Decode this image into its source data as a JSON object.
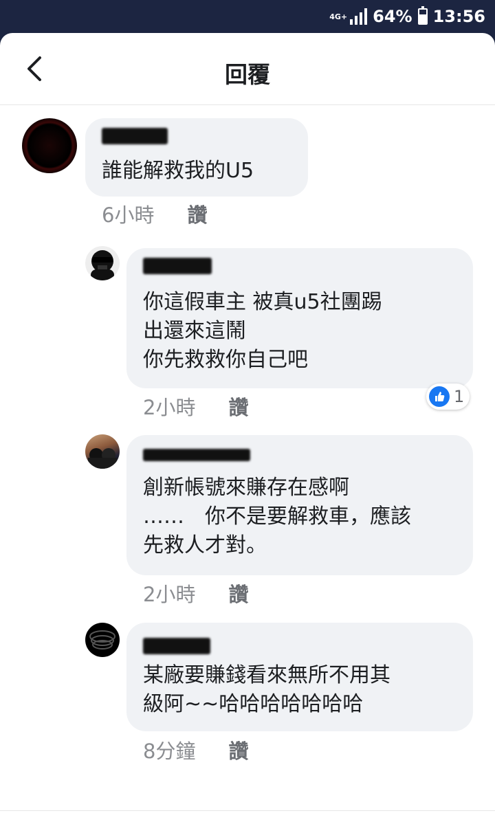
{
  "status_bar": {
    "network": "4G+",
    "battery": "64%",
    "battery_level": 0.64,
    "time": "13:56"
  },
  "header": {
    "title": "回覆",
    "back_icon": "chevron-left-icon"
  },
  "comments": [
    {
      "author": "",
      "text": "誰能解救我的U5",
      "time": "6小時",
      "like_label": "讚"
    },
    {
      "author": "",
      "text": "你這假車主 被真u5社團踢\n出還來這鬧\n你先救救你自己吧",
      "time": "2小時",
      "like_label": "讚",
      "reaction_count": "1",
      "reaction_icon": "thumbs-up-icon"
    },
    {
      "author": "",
      "text": "創新帳號來賺存在感啊\n……　你不是要解救車，應該\n先救人才對。",
      "time": "2小時",
      "like_label": "讚"
    },
    {
      "author": "",
      "text": "某廠要賺錢看來無所不用其\n級阿~~哈哈哈哈哈哈哈",
      "time": "8分鐘",
      "like_label": "讚"
    }
  ]
}
